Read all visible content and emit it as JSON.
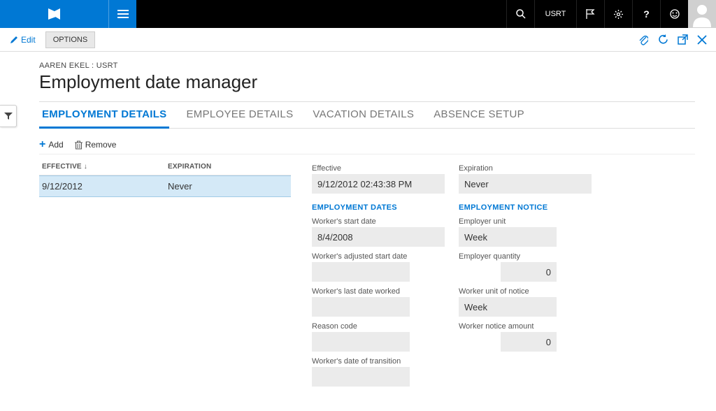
{
  "top": {
    "user_code": "USRT"
  },
  "secondbar": {
    "edit": "Edit",
    "options": "OPTIONS"
  },
  "breadcrumb": "AAREN EKEL : USRT",
  "page_title": "Employment date manager",
  "tabs": [
    {
      "label": "EMPLOYMENT DETAILS",
      "active": true
    },
    {
      "label": "EMPLOYEE DETAILS",
      "active": false
    },
    {
      "label": "VACATION DETAILS",
      "active": false
    },
    {
      "label": "ABSENCE SETUP",
      "active": false
    }
  ],
  "actions": {
    "add": "Add",
    "remove": "Remove"
  },
  "table": {
    "headers": {
      "effective": "EFFECTIVE",
      "expiration": "EXPIRATION"
    },
    "rows": [
      {
        "effective": "9/12/2012",
        "expiration": "Never"
      }
    ]
  },
  "details": {
    "left": {
      "effective_label": "Effective",
      "effective_value": "9/12/2012 02:43:38 PM",
      "dates_header": "EMPLOYMENT DATES",
      "start_label": "Worker's start date",
      "start_value": "8/4/2008",
      "adjusted_label": "Worker's adjusted start date",
      "adjusted_value": "",
      "last_worked_label": "Worker's last date worked",
      "last_worked_value": "",
      "reason_label": "Reason code",
      "reason_value": "",
      "transition_label": "Worker's date of transition",
      "transition_value": ""
    },
    "right": {
      "expiration_label": "Expiration",
      "expiration_value": "Never",
      "notice_header": "EMPLOYMENT NOTICE",
      "employer_unit_label": "Employer unit",
      "employer_unit_value": "Week",
      "employer_qty_label": "Employer quantity",
      "employer_qty_value": "0",
      "worker_unit_label": "Worker unit of notice",
      "worker_unit_value": "Week",
      "worker_amount_label": "Worker notice amount",
      "worker_amount_value": "0"
    }
  }
}
